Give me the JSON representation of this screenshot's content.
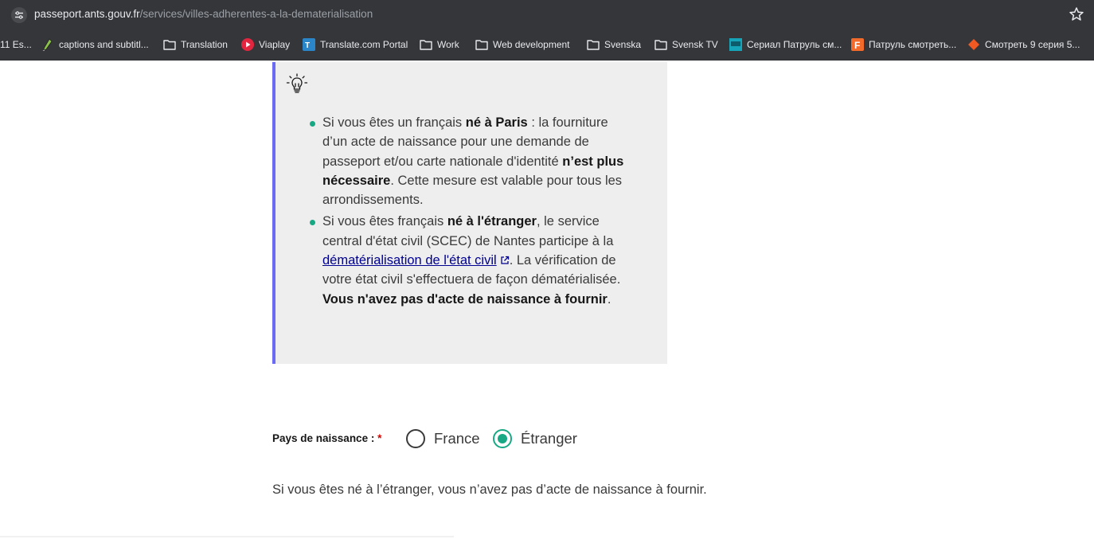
{
  "browser": {
    "url_host": "passeport.ants.gouv.fr",
    "url_path": "/services/villes-adherentes-a-la-dematerialisation"
  },
  "bookmarks": [
    {
      "label": "11 Es...",
      "icon": "none"
    },
    {
      "label": "captions and subtitl...",
      "icon": "pen-icon"
    },
    {
      "label": "Translation",
      "icon": "folder-icon"
    },
    {
      "label": "Viaplay",
      "icon": "viaplay-icon"
    },
    {
      "label": "Translate.com Portal",
      "icon": "translate-com-icon"
    },
    {
      "label": "Work",
      "icon": "folder-icon"
    },
    {
      "label": "Web development",
      "icon": "folder-icon"
    },
    {
      "label": "Svenska",
      "icon": "folder-icon"
    },
    {
      "label": "Svensk TV",
      "icon": "folder-icon"
    },
    {
      "label": "Сериал Патруль см...",
      "icon": "site-icon"
    },
    {
      "label": "Патруль смотреть...",
      "icon": "f-site-icon"
    },
    {
      "label": "Смотреть 9 серия 5...",
      "icon": "diamond-icon"
    }
  ],
  "callout": {
    "item1": {
      "t1": "Si vous êtes un français ",
      "b1": "né à Paris",
      "t2": " : la fourniture d’un acte de naissance pour une demande de passeport et/ou carte nationale d'identité ",
      "b2": "n’est plus nécessaire",
      "t3": ". Cette mesure est valable pour tous les arrondissements."
    },
    "item2": {
      "t1": "Si vous êtes français ",
      "b1": "né à l'étranger",
      "t2": ", le service central d'état civil (SCEC) de Nantes participe à la ",
      "link": "dématérialisation de l'état civil",
      "t3": ". La vérification de votre état civil s'effectuera de façon dématérialisée. ",
      "b2": "Vous n'avez pas d'acte de naissance à fournir",
      "t4": "."
    }
  },
  "form": {
    "label": "Pays de naissance :",
    "required_mark": "*",
    "options": [
      {
        "label": "France",
        "selected": false
      },
      {
        "label": "Étranger",
        "selected": true
      }
    ]
  },
  "info_text": "Si vous êtes né à l’étranger, vous n’avez pas d’acte de naissance à fournir.",
  "colors": {
    "accent_border": "#6a6af4",
    "bullet_green": "#18a883",
    "link_blue": "#000091",
    "required_red": "#ce0500"
  }
}
